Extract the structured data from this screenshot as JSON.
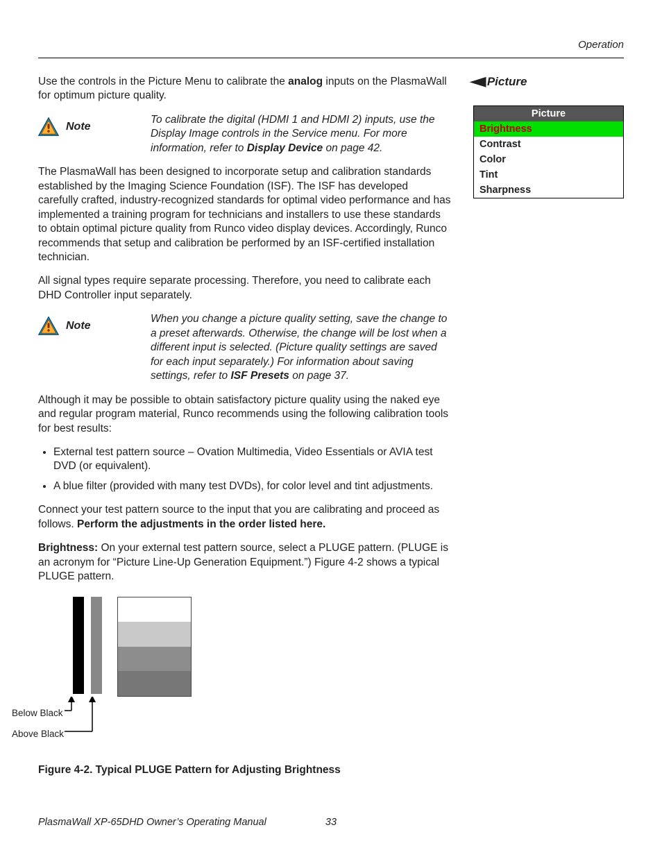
{
  "header": {
    "section": "Operation"
  },
  "side": {
    "heading": "Picture",
    "menu_title": "Picture",
    "menu_items": {
      "brightness": "Brightness",
      "contrast": "Contrast",
      "color": "Color",
      "tint": "Tint",
      "sharpness": "Sharpness"
    }
  },
  "para": {
    "intro_pre": "Use the controls in the Picture Menu to calibrate the ",
    "intro_bold": "analog",
    "intro_post": " inputs on the PlasmaWall for optimum picture quality.",
    "isf": "The PlasmaWall has been designed to incorporate setup and calibration standards established by the Imaging Science Foundation (ISF). The ISF has developed carefully crafted, industry-recognized standards for optimal video performance and has implemented a training program for technicians and installers to use these standards to obtain optimal picture quality from Runco video display devices. Accordingly, Runco recommends that setup and calibration be performed by an ISF-certified installation technician.",
    "sig": "All signal types require separate processing. Therefore, you need to calibrate each DHD Controller input separately.",
    "tools_intro": "Although it may be possible to obtain satisfactory picture quality using the naked eye and regular program material, Runco recommends using the following calibration tools for best results:",
    "connect_pre": "Connect your test pattern source to the input that you are calibrating and proceed as follows. ",
    "connect_bold": "Perform the adjustments in the order listed here.",
    "bright_label": "Brightness: ",
    "bright_body": "On your external test pattern source, select a PLUGE pattern. (PLUGE is an acronym for “Picture Line-Up Generation Equipment.”) Figure 4-2 shows a typical PLUGE pattern."
  },
  "notes": {
    "label": "Note",
    "n1_pre": "To calibrate the digital (HDMI 1 and HDMI 2) inputs, use the Display Image controls in the Service menu. For more information, refer to ",
    "n1_bold": "Display Device",
    "n1_post": " on page 42.",
    "n2_pre": "When you change a picture quality setting, save the change to a preset afterwards. Otherwise, the change will be lost when a different input is selected. (Picture quality settings are saved for each input separately.) For information about saving settings, refer to ",
    "n2_bold": "ISF Presets",
    "n2_post": " on page 37."
  },
  "bullets": {
    "b1": "External test pattern source – Ovation Multimedia, Video Essentials or AVIA test DVD (or equivalent).",
    "b2": "A blue filter (provided with many test DVDs), for color level and tint adjustments."
  },
  "figure": {
    "below": "Below Black",
    "above": "Above Black",
    "caption": "Figure 4-2. Typical PLUGE Pattern for Adjusting Brightness"
  },
  "footer": {
    "title": "PlasmaWall XP-65DHD Owner’s Operating Manual",
    "page": "33"
  }
}
